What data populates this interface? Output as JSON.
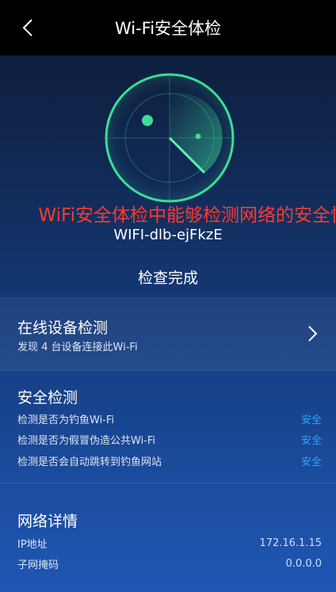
{
  "header": {
    "title": "Wi-Fi安全体检",
    "back_icon": "chevron-left-icon"
  },
  "promo_banner": "WiFi安全体检中能够检测网络的安全性",
  "network": {
    "ssid": "WIFI-dlb-ejFkzE"
  },
  "scan_status": "检查完成",
  "online_devices": {
    "title": "在线设备检测",
    "subtitle": "发现 4 台设备连接此Wi-Fi",
    "chevron_icon": "chevron-right-icon"
  },
  "security_check": {
    "title": "安全检测",
    "items": [
      {
        "label": "检测是否为钓鱼Wi-Fi",
        "result": "安全"
      },
      {
        "label": "检测是否为假冒伪造公共Wi-Fi",
        "result": "安全"
      },
      {
        "label": "检测是否会自动跳转到钓鱼网站",
        "result": "安全"
      }
    ]
  },
  "network_details": {
    "title": "网络详情",
    "rows": [
      {
        "label": "IP地址",
        "value": "172.16.1.15"
      },
      {
        "label": "子网掩码",
        "value": "0.0.0.0"
      }
    ]
  },
  "colors": {
    "accent_green": "#3ddc97",
    "safe_blue": "#2aa6ff",
    "promo_red": "#ff3a2e"
  }
}
